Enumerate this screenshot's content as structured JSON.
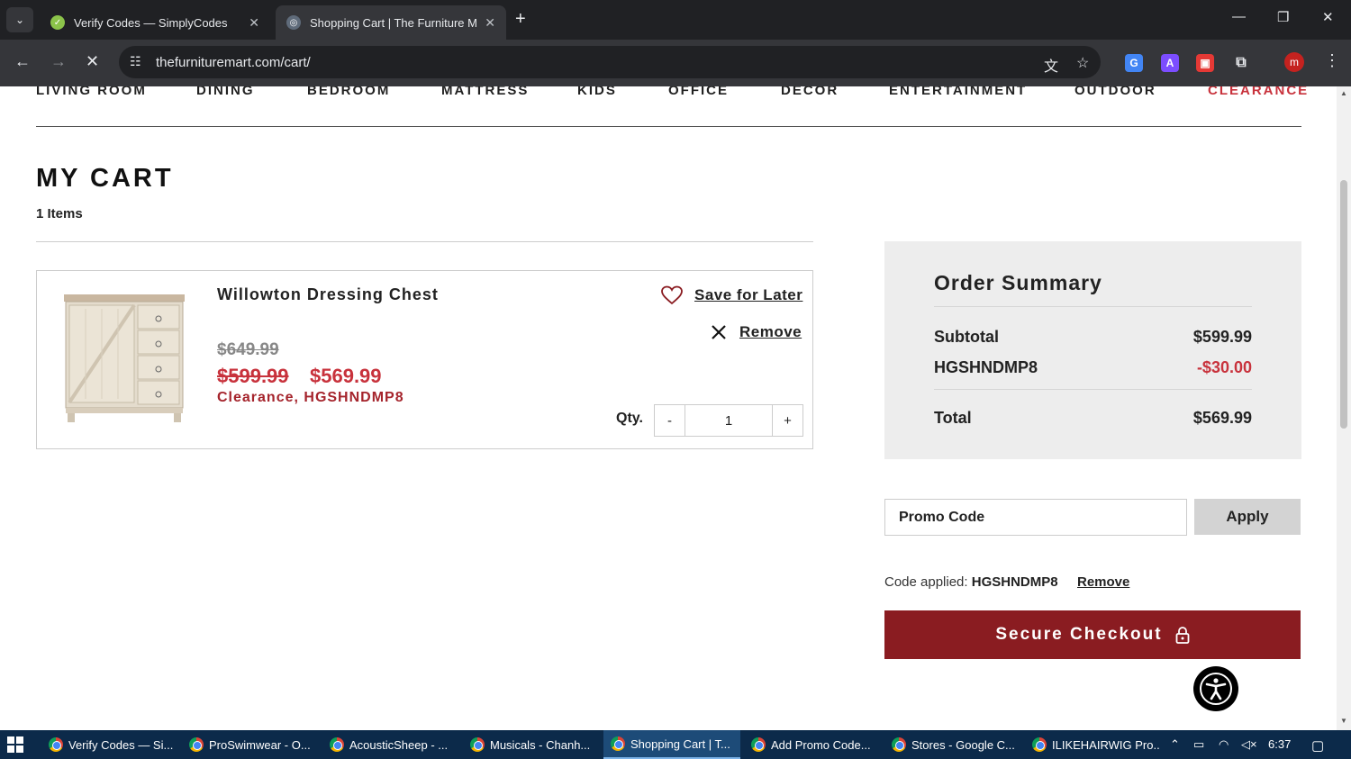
{
  "browser": {
    "tabs": [
      {
        "title": "Verify Codes — SimplyCodes",
        "active": false
      },
      {
        "title": "Shopping Cart | The Furniture Mart",
        "active": true
      }
    ],
    "url": "thefurnituremart.com/cart/",
    "profile_initial": "m"
  },
  "nav": {
    "categories": [
      "LIVING ROOM",
      "DINING",
      "BEDROOM",
      "MATTRESS",
      "KIDS",
      "OFFICE",
      "DECOR",
      "ENTERTAINMENT",
      "OUTDOOR",
      "CLEARANCE"
    ]
  },
  "cart": {
    "title": "MY CART",
    "count_label": "1 Items",
    "items": [
      {
        "name": "Willowton Dressing Chest",
        "original_price": "$649.99",
        "sale_price": "$599.99",
        "final_price": "$569.99",
        "tag": "Clearance, HGSHNDMP8",
        "save_label": "Save for Later",
        "remove_label": "Remove",
        "qty_label": "Qty.",
        "qty": "1",
        "minus": "-",
        "plus": "+"
      }
    ]
  },
  "summary": {
    "title": "Order Summary",
    "subtotal_label": "Subtotal",
    "subtotal": "$599.99",
    "discount_label": "HGSHNDMP8",
    "discount": "-$30.00",
    "total_label": "Total",
    "total": "$569.99"
  },
  "promo": {
    "placeholder": "Promo Code",
    "apply_label": "Apply",
    "applied_prefix": "Code applied:",
    "applied_code": "HGSHNDMP8",
    "remove_label": "Remove"
  },
  "checkout": {
    "label": "Secure Checkout"
  },
  "taskbar": {
    "items": [
      "Verify Codes — Si...",
      "ProSwimwear - O...",
      "AcousticSheep - ...",
      "Musicals - Chanh...",
      "Shopping Cart | T...",
      "Add Promo Code...",
      "Stores - Google C...",
      "ILIKEHAIRWIG Pro..."
    ],
    "active_index": 4,
    "time": "6:37"
  },
  "colors": {
    "accent": "#8a1c21",
    "sale": "#c8323c",
    "summary_bg": "#ededed"
  }
}
